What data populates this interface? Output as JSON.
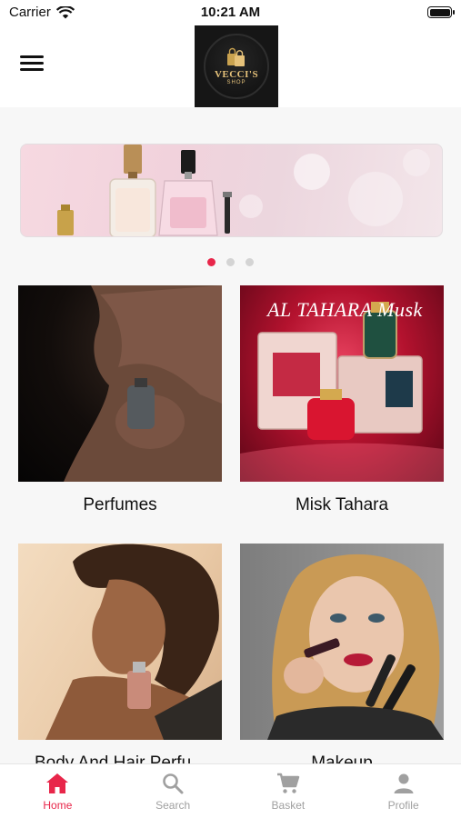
{
  "status_bar": {
    "carrier": "Carrier",
    "time": "10:21 AM"
  },
  "header": {
    "logo_name": "VECCI'S",
    "logo_sub": "SHOP"
  },
  "carousel": {
    "slide_count": 3,
    "active_index": 0
  },
  "categories": [
    {
      "label": "Perfumes"
    },
    {
      "label": "Misk Tahara",
      "artwork_text": "AL TAHARA Musk"
    },
    {
      "label": "Body And Hair Perfu..."
    },
    {
      "label": "Makeup"
    }
  ],
  "tabs": [
    {
      "label": "Home",
      "icon": "home-icon",
      "active": true
    },
    {
      "label": "Search",
      "icon": "search-icon",
      "active": false
    },
    {
      "label": "Basket",
      "icon": "cart-icon",
      "active": false
    },
    {
      "label": "Profile",
      "icon": "person-icon",
      "active": false
    }
  ],
  "colors": {
    "accent": "#e8264a",
    "inactive": "#a0a0a0",
    "logo_gold": "#e6c27a"
  }
}
